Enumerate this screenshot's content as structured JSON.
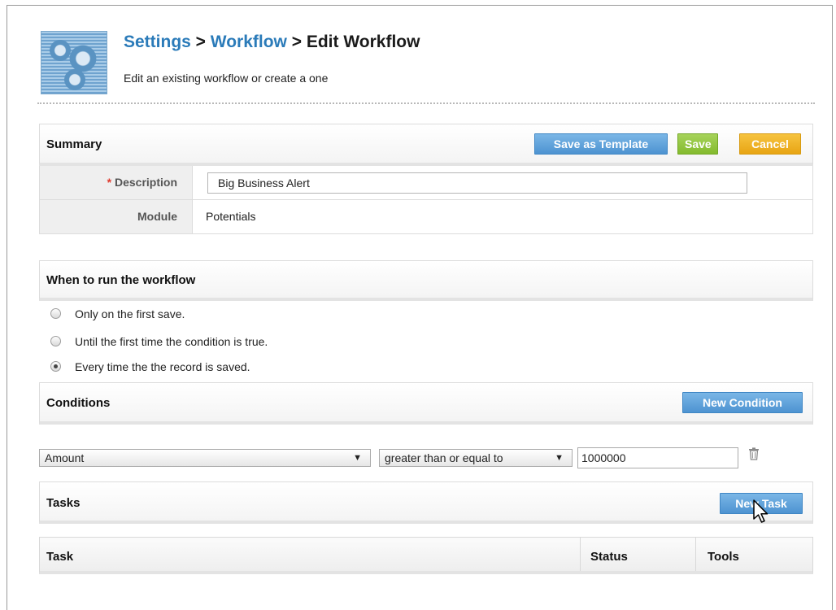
{
  "header": {
    "breadcrumb": {
      "settings": "Settings",
      "sep1": " > ",
      "workflow": "Workflow",
      "sep2": " > ",
      "current": "Edit Workflow"
    },
    "subtitle": "Edit an existing workflow or create a one",
    "logo_icon": "gears-grid-icon"
  },
  "summary": {
    "title": "Summary",
    "buttons": {
      "save_as_template": "Save as Template",
      "save": "Save",
      "cancel": "Cancel"
    },
    "description_label": "Description",
    "required_marker": "*",
    "description_value": "Big Business Alert",
    "module_label": "Module",
    "module_value": "Potentials"
  },
  "run": {
    "title": "When to run the workflow",
    "options": [
      {
        "label": "Only on the first save.",
        "checked": false
      },
      {
        "label": "Until the first time the condition is true.",
        "checked": false
      },
      {
        "label": "Every time the the record is saved.",
        "checked": true
      }
    ]
  },
  "conditions": {
    "title": "Conditions",
    "new_button": "New Condition",
    "rows": [
      {
        "field": "Amount",
        "operator": "greater than or equal to",
        "value": "1000000",
        "delete_icon": "trash-icon"
      }
    ]
  },
  "tasks": {
    "title": "Tasks",
    "new_button": "New Task",
    "columns": [
      "Task",
      "Status",
      "Tools"
    ]
  },
  "colors": {
    "link_blue": "#2b7bb9",
    "button_blue": "#4d93d1",
    "button_green": "#84bb2e",
    "button_orange": "#e8a514",
    "required_red": "#e03b2f"
  }
}
